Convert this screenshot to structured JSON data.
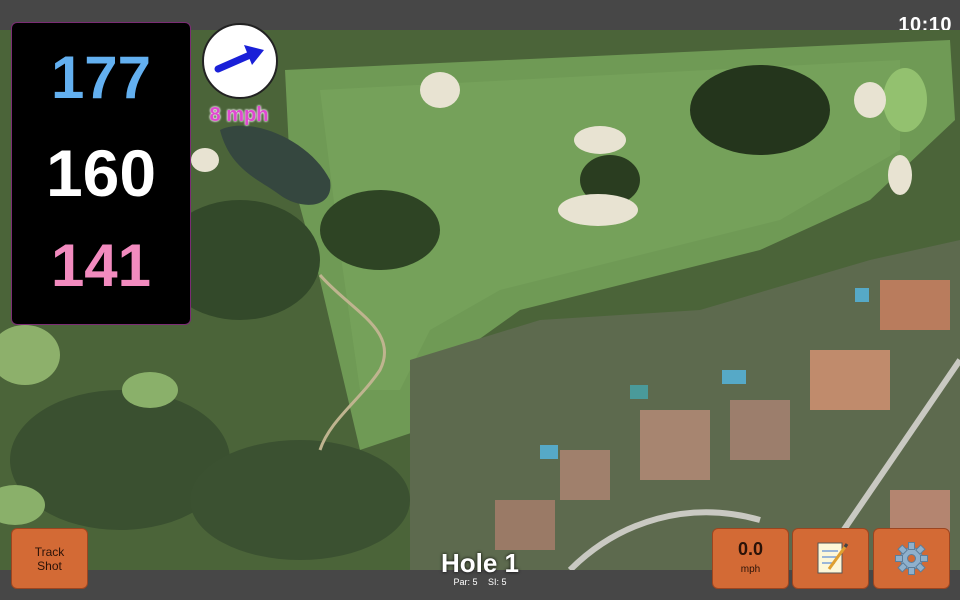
{
  "status": {
    "time": "10:10"
  },
  "distances": {
    "back": "177",
    "middle": "160",
    "front": "141"
  },
  "wind": {
    "speed": "8 mph",
    "arrow_color": "#1a20d8"
  },
  "hole": {
    "title": "Hole 1",
    "par": "Par: 5",
    "stroke_index": "SI: 5"
  },
  "buttons": {
    "track_shot_line1": "Track",
    "track_shot_line2": "Shot",
    "speed_value": "0.0",
    "speed_unit": "mph",
    "notes_icon": "notepad-icon",
    "settings_icon": "gear-icon"
  },
  "colors": {
    "button_orange": "#d36a35",
    "back_distance": "#63b0f0",
    "front_distance": "#f28bbf",
    "wind_text": "#e04ad0"
  }
}
